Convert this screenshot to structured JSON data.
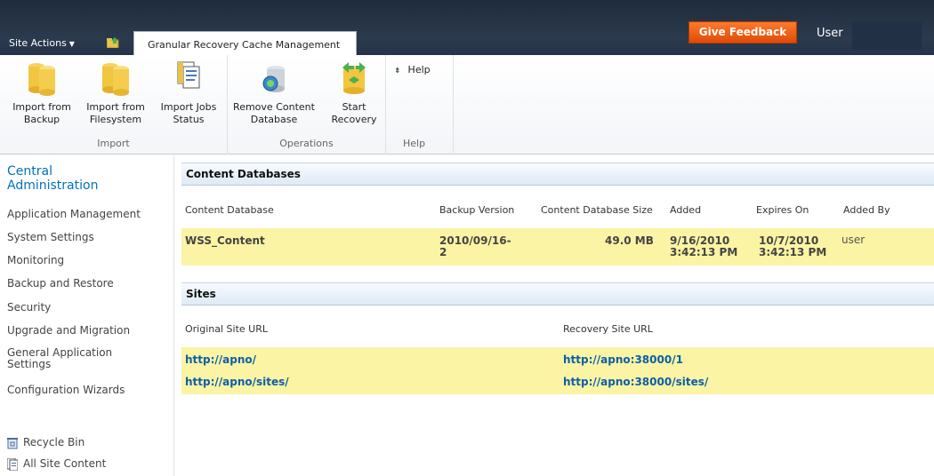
{
  "topbar": {
    "site_actions": "Site Actions",
    "active_tab": "Granular Recovery Cache Management",
    "feedback": "Give Feedback",
    "user": "User"
  },
  "ribbon": {
    "groups": [
      {
        "label": "Import"
      },
      {
        "label": "Operations"
      },
      {
        "label": "Help"
      }
    ],
    "buttons": {
      "import_backup": [
        "Import from",
        "Backup"
      ],
      "import_filesystem": [
        "Import from",
        "Filesystem"
      ],
      "import_jobs": [
        "Import Jobs",
        "Status"
      ],
      "remove_db": [
        "Remove Content",
        "Database"
      ],
      "start_recovery": [
        "Start",
        "Recovery"
      ],
      "help": "Help"
    }
  },
  "leftnav": {
    "title": [
      "Central",
      "Administration"
    ],
    "items": [
      "Application Management",
      "System Settings",
      "Monitoring",
      "Backup and Restore",
      "Security",
      "Upgrade and Migration",
      "General Application",
      "Settings",
      "Configuration Wizards"
    ],
    "utility": [
      "Recycle Bin",
      "All Site Content"
    ]
  },
  "content_databases": {
    "header": "Content Databases",
    "columns": [
      "Content Database",
      "Backup Version",
      "Content Database Size",
      "Added",
      "Expires On",
      "Added By"
    ],
    "rows": [
      {
        "name": "WSS_Content",
        "backup_version": [
          "2010/09/16-",
          "2"
        ],
        "size": "49.0 MB",
        "added": [
          "9/16/2010",
          "3:42:13 PM"
        ],
        "expires": [
          "10/7/2010",
          "3:42:13 PM"
        ],
        "added_by": "user"
      }
    ]
  },
  "sites": {
    "header": "Sites",
    "columns": [
      "Original Site URL",
      "Recovery Site URL"
    ],
    "rows": [
      {
        "original": "http://apno/",
        "recovery": "http://apno:38000/1"
      },
      {
        "original": "http://apno/sites/",
        "recovery": "http://apno:38000/sites/"
      }
    ]
  },
  "colors": {
    "topbar": "#25344a",
    "feedback": "#e85a10",
    "highlight": "#fbf4a4",
    "link": "#0b5fa8",
    "nav_title": "#0072bc"
  },
  "icons": [
    "caret-down-icon",
    "navigate-up-icon",
    "database-icon",
    "document-icon",
    "database-remove-icon",
    "database-recover-icon",
    "help-arrow-icon",
    "recycle-bin-icon",
    "all-content-icon"
  ]
}
